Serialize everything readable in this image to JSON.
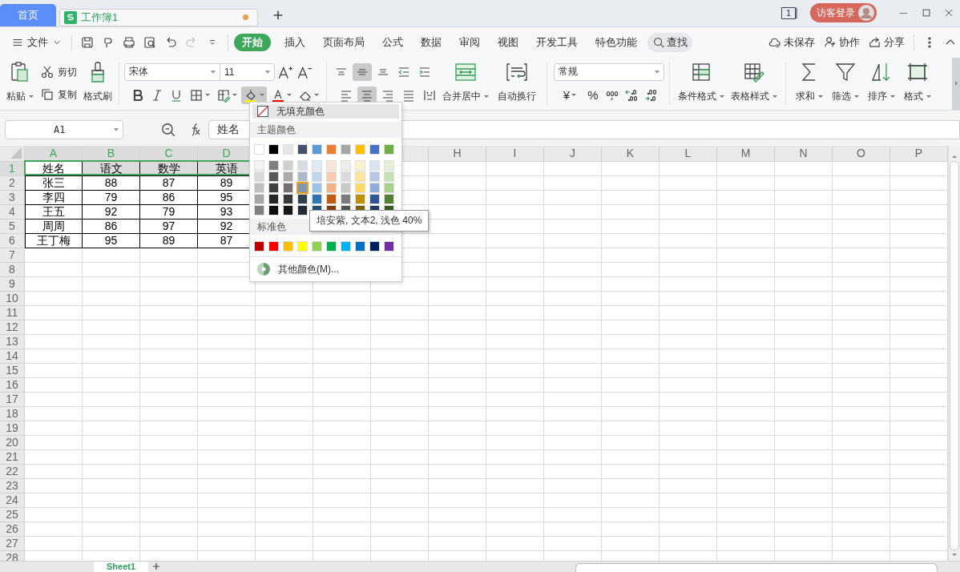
{
  "title_tabs": [
    {
      "label": "首页",
      "kind": "home",
      "selected": false,
      "unsaved": false
    },
    {
      "label": "工作簿1",
      "kind": "sheet",
      "selected": true,
      "unsaved": true
    }
  ],
  "window_count": "1",
  "login": "访客登录",
  "menu": {
    "file": "文件",
    "tabs": [
      {
        "label": "开始",
        "selected": true
      },
      {
        "label": "插入",
        "selected": false
      },
      {
        "label": "页面布局",
        "selected": false
      },
      {
        "label": "公式",
        "selected": false
      },
      {
        "label": "数据",
        "selected": false
      },
      {
        "label": "审阅",
        "selected": false
      },
      {
        "label": "视图",
        "selected": false
      },
      {
        "label": "开发工具",
        "selected": false
      },
      {
        "label": "特色功能",
        "selected": false
      }
    ],
    "search": "查找",
    "actions": [
      {
        "label": "未保存",
        "kind": "cloud"
      },
      {
        "label": "协作",
        "kind": "user"
      },
      {
        "label": "分享",
        "kind": "share"
      }
    ]
  },
  "ribbon": {
    "paste": "粘贴",
    "cut": "剪切",
    "copy": "复制",
    "format_painter": "格式刷",
    "font": "宋体",
    "size": "11",
    "fill_pressed": true,
    "align_top": [
      {
        "kind": "top",
        "active": false
      },
      {
        "kind": "middle",
        "active": true
      },
      {
        "kind": "bottom",
        "active": false
      },
      {
        "kind": "outdent",
        "active": false
      },
      {
        "kind": "indent",
        "active": false
      }
    ],
    "align_bottom": [
      {
        "kind": "left",
        "active": false
      },
      {
        "kind": "center",
        "active": true
      },
      {
        "kind": "right",
        "active": false
      },
      {
        "kind": "justify",
        "active": false
      },
      {
        "kind": "distributed",
        "active": false
      }
    ],
    "merge": "合并居中",
    "wrap": "自动换行",
    "number_format": "常规",
    "currency": "¥",
    "percent": "%",
    "styles": [
      {
        "label": "条件格式",
        "kind": "conditional"
      },
      {
        "label": "表格样式",
        "kind": "table"
      }
    ],
    "editing": [
      {
        "label": "求和",
        "kind": "sum"
      },
      {
        "label": "筛选",
        "kind": "filter"
      },
      {
        "label": "排序",
        "kind": "sort"
      },
      {
        "label": "格式",
        "kind": "format"
      }
    ]
  },
  "formula_bar": {
    "name_box": "A1",
    "formula": "姓名"
  },
  "grid": {
    "columns": [
      {
        "label": "A",
        "selected": true
      },
      {
        "label": "B",
        "selected": true
      },
      {
        "label": "C",
        "selected": true
      },
      {
        "label": "D",
        "selected": true
      },
      null,
      null,
      null,
      {
        "label": "H",
        "selected": false
      },
      {
        "label": "I",
        "selected": false
      },
      {
        "label": "J",
        "selected": false
      },
      {
        "label": "K",
        "selected": false
      },
      {
        "label": "L",
        "selected": false
      },
      {
        "label": "M",
        "selected": false
      },
      {
        "label": "N",
        "selected": false
      },
      {
        "label": "O",
        "selected": false
      },
      {
        "label": "P",
        "selected": false
      }
    ],
    "rows": [
      {
        "label": "1",
        "selected": true
      },
      {
        "label": "2",
        "selected": false
      },
      {
        "label": "3",
        "selected": false
      },
      {
        "label": "4",
        "selected": false
      },
      {
        "label": "5",
        "selected": false
      },
      {
        "label": "6",
        "selected": false
      },
      {
        "label": "7",
        "selected": false
      },
      {
        "label": "8",
        "selected": false
      },
      {
        "label": "9",
        "selected": false
      },
      {
        "label": "10",
        "selected": false
      },
      {
        "label": "11",
        "selected": false
      },
      {
        "label": "12",
        "selected": false
      },
      {
        "label": "13",
        "selected": false
      },
      {
        "label": "14",
        "selected": false
      },
      {
        "label": "15",
        "selected": false
      },
      {
        "label": "16",
        "selected": false
      },
      {
        "label": "17",
        "selected": false
      },
      {
        "label": "18",
        "selected": false
      },
      {
        "label": "19",
        "selected": false
      },
      {
        "label": "20",
        "selected": false
      },
      {
        "label": "21",
        "selected": false
      },
      {
        "label": "22",
        "selected": false
      },
      {
        "label": "23",
        "selected": false
      },
      {
        "label": "24",
        "selected": false
      },
      {
        "label": "25",
        "selected": false
      },
      {
        "label": "26",
        "selected": false
      },
      {
        "label": "27",
        "selected": false
      },
      {
        "label": "28",
        "selected": false
      }
    ],
    "cells": [
      [
        "姓名",
        "语文",
        "数学",
        "英语"
      ],
      [
        "张三",
        "88",
        "87",
        "89"
      ],
      [
        "李四",
        "79",
        "86",
        "95"
      ],
      [
        "王五",
        "92",
        "79",
        "93"
      ],
      [
        "周周",
        "86",
        "97",
        "92"
      ],
      [
        "王丁梅",
        "95",
        "89",
        "87"
      ]
    ]
  },
  "fill_menu": {
    "no_fill": "无填充颜色",
    "theme_title": "主题颜色",
    "theme_colors": [
      {
        "color": "#ffffff"
      },
      {
        "color": "#000000"
      },
      {
        "color": "#e7e6e6"
      },
      {
        "color": "#44546a"
      },
      {
        "color": "#5b9bd5"
      },
      {
        "color": "#ed7d31"
      },
      {
        "color": "#a5a5a5"
      },
      {
        "color": "#ffc000"
      },
      {
        "color": "#4472c4"
      },
      {
        "color": "#70ad47"
      }
    ],
    "theme_shades": [
      [
        {
          "color": "#f2f2f2",
          "selected": false
        },
        {
          "color": "#808080",
          "selected": false
        },
        {
          "color": "#d0cece",
          "selected": false
        },
        {
          "color": "#d6dce4",
          "selected": false
        },
        {
          "color": "#deebf7",
          "selected": false
        },
        {
          "color": "#fbe5d6",
          "selected": false
        },
        {
          "color": "#ededed",
          "selected": false
        },
        {
          "color": "#fff2cc",
          "selected": false
        },
        {
          "color": "#dae3f3",
          "selected": false
        },
        {
          "color": "#e2f0d9",
          "selected": false
        }
      ],
      [
        {
          "color": "#d9d9d9",
          "selected": false
        },
        {
          "color": "#595959",
          "selected": false
        },
        {
          "color": "#aeaaaa",
          "selected": false
        },
        {
          "color": "#adb9ca",
          "selected": false
        },
        {
          "color": "#bdd7ee",
          "selected": false
        },
        {
          "color": "#f8cbad",
          "selected": false
        },
        {
          "color": "#dbdbdb",
          "selected": false
        },
        {
          "color": "#ffe699",
          "selected": false
        },
        {
          "color": "#b4c7e7",
          "selected": false
        },
        {
          "color": "#c5e0b4",
          "selected": false
        }
      ],
      [
        {
          "color": "#bfbfbf",
          "selected": false
        },
        {
          "color": "#404040",
          "selected": false
        },
        {
          "color": "#767171",
          "selected": false
        },
        {
          "color": "#8496b0",
          "selected": true
        },
        {
          "color": "#9dc3e6",
          "selected": false
        },
        {
          "color": "#f4b183",
          "selected": false
        },
        {
          "color": "#c9c9c9",
          "selected": false
        },
        {
          "color": "#ffd966",
          "selected": false
        },
        {
          "color": "#8faadc",
          "selected": false
        },
        {
          "color": "#a9d18e",
          "selected": false
        }
      ],
      [
        {
          "color": "#a6a6a6",
          "selected": false
        },
        {
          "color": "#262626",
          "selected": false
        },
        {
          "color": "#3b3838",
          "selected": false
        },
        {
          "color": "#333f4f",
          "selected": false
        },
        {
          "color": "#2e75b6",
          "selected": false
        },
        {
          "color": "#c55a11",
          "selected": false
        },
        {
          "color": "#7b7b7b",
          "selected": false
        },
        {
          "color": "#bf9000",
          "selected": false
        },
        {
          "color": "#2f5597",
          "selected": false
        },
        {
          "color": "#548235",
          "selected": false
        }
      ],
      [
        {
          "color": "#808080",
          "selected": false
        },
        {
          "color": "#0d0d0d",
          "selected": false
        },
        {
          "color": "#181717",
          "selected": false
        },
        {
          "color": "#222a35",
          "selected": false
        },
        {
          "color": "#1f4e79",
          "selected": false
        },
        {
          "color": "#843c0c",
          "selected": false
        },
        {
          "color": "#525252",
          "selected": false
        },
        {
          "color": "#7f6000",
          "selected": false
        },
        {
          "color": "#203864",
          "selected": false
        },
        {
          "color": "#385723",
          "selected": false
        }
      ]
    ],
    "standard_title": "标准色",
    "standard_colors": [
      {
        "color": "#c00000"
      },
      {
        "color": "#ff0000"
      },
      {
        "color": "#ffc000"
      },
      {
        "color": "#ffff00"
      },
      {
        "color": "#92d050"
      },
      {
        "color": "#00b050"
      },
      {
        "color": "#00b0f0"
      },
      {
        "color": "#0070c0"
      },
      {
        "color": "#002060"
      },
      {
        "color": "#7030a0"
      }
    ],
    "more": "其他颜色(M)...",
    "tooltip": "培安紫, 文本2, 浅色 40%"
  },
  "sheet_tab": "Sheet1"
}
